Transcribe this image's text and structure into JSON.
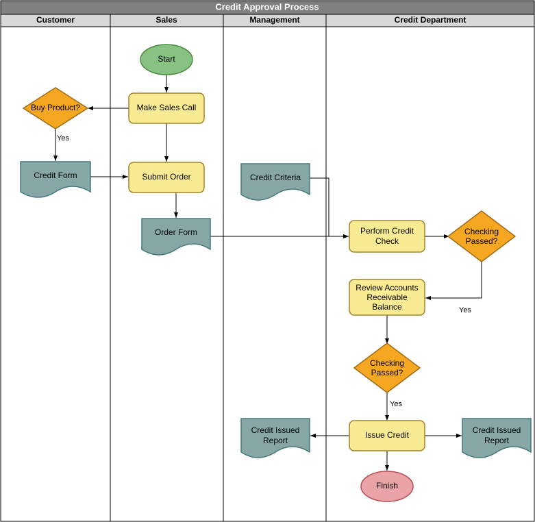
{
  "title": "Credit Approval Process",
  "lanes": {
    "customer": {
      "label": "Customer"
    },
    "sales": {
      "label": "Sales"
    },
    "management": {
      "label": "Management"
    },
    "credit": {
      "label": "Credit Department"
    }
  },
  "nodes": {
    "start": {
      "label": "Start"
    },
    "make_sales_call": {
      "label": "Make Sales Call"
    },
    "buy_product": {
      "label": "Buy Product?"
    },
    "credit_form": {
      "label": "Credit Form"
    },
    "submit_order": {
      "label": "Submit Order"
    },
    "order_form": {
      "label": "Order Form"
    },
    "credit_criteria": {
      "label": "Credit Criteria"
    },
    "perform_credit": {
      "line1": "Perform Credit",
      "line2": "Check"
    },
    "checking_passed1": {
      "line1": "Checking",
      "line2": "Passed?"
    },
    "review_ar": {
      "line1": "Review Accounts",
      "line2": "Receivable",
      "line3": "Balance"
    },
    "checking_passed2": {
      "line1": "Checking",
      "line2": "Passed?"
    },
    "issue_credit": {
      "label": "Issue Credit"
    },
    "credit_report_l": {
      "line1": "Credit Issued",
      "line2": "Report"
    },
    "credit_report_r": {
      "line1": "Credit Issued",
      "line2": "Report"
    },
    "finish": {
      "label": "Finish"
    }
  },
  "edgeLabels": {
    "yes1": "Yes",
    "yes2": "Yes",
    "yes3": "Yes"
  }
}
